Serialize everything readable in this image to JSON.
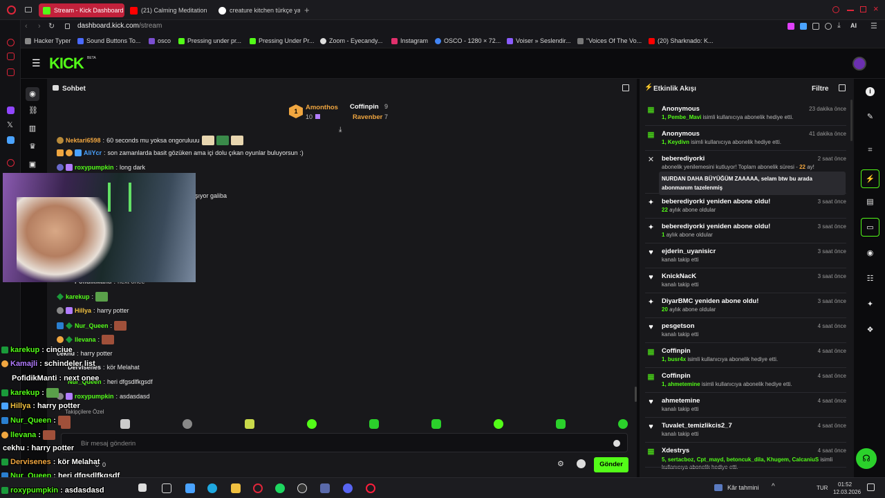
{
  "browser": {
    "tabs": [
      {
        "label": "Stream - Kick Dashboard",
        "active": true,
        "color": "#53fc18"
      },
      {
        "label": "(21) Calming Meditation",
        "active": false,
        "color": "#ff0000"
      },
      {
        "label": "creature kitchen türkçe ya",
        "active": false,
        "color": "#4285f4"
      }
    ],
    "url_host": "dashboard.kick.com",
    "url_path": "/stream",
    "bookmarks": [
      "Hacker Typer",
      "Sound Buttons To...",
      "osco",
      "Pressing under pr...",
      "Pressing Under Pr...",
      "Zoom - Eyecandy...",
      "Instagram",
      "OSCO - 1280 × 72...",
      "Voiser » Seslendir...",
      "\"Voices Of The Vo...",
      "(20) Sharknado: K..."
    ],
    "ai_label": "AI"
  },
  "kick": {
    "logo": "KICK",
    "beta": "BETA"
  },
  "chat": {
    "title": "Sohbet",
    "pinned": {
      "rank": "1",
      "top_user": "Amonthos",
      "top_count": "10",
      "second_user": "Coffinpin",
      "second_count": "9",
      "third_user": "Ravenber",
      "third_count": "7"
    },
    "messages": [
      {
        "user": "Nektari6598",
        "text": "60 seconds mu yoksa ongoruluuu",
        "color": "#f0a640"
      },
      {
        "user": "AliYcr",
        "text": "son zamanlarda basit gözüken ama içi dolu çıkan oyunlar buluyorsun :)",
        "color": "#4aa3ff"
      },
      {
        "user": "roxypumpkin",
        "text": "long dark",
        "color": "#53fc18"
      },
      {
        "user": "",
        "text": "şıyor galiba",
        "color": "#e8e8e8"
      },
      {
        "user": "PofidikManti",
        "text": "next onee",
        "color": "#bbbbbb"
      },
      {
        "user": "karekup",
        "text": "",
        "color": "#53fc18"
      },
      {
        "user": "Hillya",
        "text": "harry potter",
        "color": "#f0c040"
      },
      {
        "user": "Nur_Queen",
        "text": "",
        "color": "#53fc18"
      },
      {
        "user": "llevana",
        "text": "",
        "color": "#53fc18"
      },
      {
        "user": "cekhu",
        "text": "harry potter",
        "color": "#e8e8e8"
      },
      {
        "user": "Dervisenes",
        "text": "kör Melahat",
        "color": "#e8e8e8"
      },
      {
        "user": "Nur_Queen",
        "text": "heri dfgsdlfkgsdf",
        "color": "#53fc18"
      },
      {
        "user": "roxypumpkin",
        "text": "asdasdasd",
        "color": "#53fc18"
      }
    ],
    "followers_only": "Takipçilere Özel",
    "input_placeholder": "Bir mesaj gönderin",
    "send_label": "Gönder",
    "counter_a": "0",
    "counter_b": "0"
  },
  "overlay_chat": [
    {
      "user": "karekup",
      "text": "cinciue",
      "color": "#53fc18"
    },
    {
      "user": "Kamajli",
      "text": "schindeler list",
      "color": "#b27cff"
    },
    {
      "user": "PofidikManti",
      "text": "next onee",
      "color": "#ffffff"
    },
    {
      "user": "karekup",
      "text": "",
      "color": "#53fc18"
    },
    {
      "user": "Hillya",
      "text": "harry potter",
      "color": "#f0c040"
    },
    {
      "user": "Nur_Queen",
      "text": "",
      "color": "#53fc18"
    },
    {
      "user": "llevana",
      "text": "",
      "color": "#53fc18"
    },
    {
      "user": "cekhu",
      "text": "harry potter",
      "color": "#ffffff"
    },
    {
      "user": "Dervisenes",
      "text": "kör Melahat",
      "color": "#f0a640"
    },
    {
      "user": "Nur_Queen",
      "text": "heri dfgsdlfkgsdf",
      "color": "#53fc18"
    },
    {
      "user": "roxypumpkin",
      "text": "asdasdasd",
      "color": "#53fc18"
    }
  ],
  "activity": {
    "title": "Etkinlik Akışı",
    "filter": "Filtre",
    "items": [
      {
        "icon": "gift-icon",
        "title": "Anonymous",
        "sub_highlight": "1, Pembe_Mavi",
        "sub": "isimli kullanıcıya abonelik hediye etti.",
        "time": "23 dakika önce"
      },
      {
        "icon": "gift-icon",
        "title": "Anonymous",
        "sub_highlight": "1, Keydivn",
        "sub": "isimli kullanıcıya abonelik hediye etti.",
        "time": "41 dakika önce"
      },
      {
        "icon": "star-icon",
        "title": "beberediyorki",
        "sub_highlight": "",
        "sub": "abonelik yenilemesini kutluyor! Toplam abonelik süresi -",
        "sub_extra": "22",
        "sub_tail": "ay!",
        "message": "NURDAN DAHA BÜYÜĞÜM ZAAAAA, selam btw bu arada abonmanım tazelenmiş",
        "time": "2 saat önce"
      },
      {
        "icon": "sparkle-icon",
        "title": "beberediyorki yeniden abone oldu!",
        "sub_highlight": "22",
        "sub": "aylık abone oldular",
        "time": "3 saat önce"
      },
      {
        "icon": "sparkle-icon",
        "title": "beberediyorki yeniden abone oldu!",
        "sub_highlight": "1",
        "sub": "aylık abone oldular",
        "time": "3 saat önce"
      },
      {
        "icon": "heart-icon",
        "title": "ejderin_uyanisicr",
        "sub_highlight": "",
        "sub": "kanalı takip etti",
        "time": "3 saat önce"
      },
      {
        "icon": "heart-icon",
        "title": "KnickNacK",
        "sub_highlight": "",
        "sub": "kanalı takip etti",
        "time": "3 saat önce"
      },
      {
        "icon": "sparkle-icon",
        "title": "DiyarBMC yeniden abone oldu!",
        "sub_highlight": "20",
        "sub": "aylık abone oldular",
        "time": "3 saat önce"
      },
      {
        "icon": "heart-icon",
        "title": "pesgetson",
        "sub_highlight": "",
        "sub": "kanalı takip etti",
        "time": "4 saat önce"
      },
      {
        "icon": "gift-icon",
        "title": "Coffinpin",
        "sub_highlight": "1, busr4x",
        "sub": "isimli kullanıcıya abonelik hediye etti.",
        "time": "4 saat önce"
      },
      {
        "icon": "gift-icon",
        "title": "Coffinpin",
        "sub_highlight": "1, ahmetemine",
        "sub": "isimli kullanıcıya abonelik hediye etti.",
        "time": "4 saat önce"
      },
      {
        "icon": "heart-icon",
        "title": "ahmetemine",
        "sub_highlight": "",
        "sub": "kanalı takip etti",
        "time": "4 saat önce"
      },
      {
        "icon": "heart-icon",
        "title": "Tuvalet_temizlikcis2_7",
        "sub_highlight": "",
        "sub": "kanalı takip etti",
        "time": "4 saat önce"
      },
      {
        "icon": "gift-icon",
        "title": "Xdestrys",
        "sub_highlight": "5, sertacboz, Cpt_mayd, betoncuk_dila, Khugem, CalcaniuS",
        "sub": "isimli kullanıcıya abonelik hediye etti.",
        "time": "4 saat önce"
      }
    ]
  },
  "taskbar": {
    "weather": "Kâr tahmini",
    "lang": "TUR",
    "time": "01:52",
    "date": "12.03.2026"
  },
  "colors": {
    "kick_green": "#53fc18",
    "bg": "#0b0b0d",
    "panel": "#18181b"
  }
}
